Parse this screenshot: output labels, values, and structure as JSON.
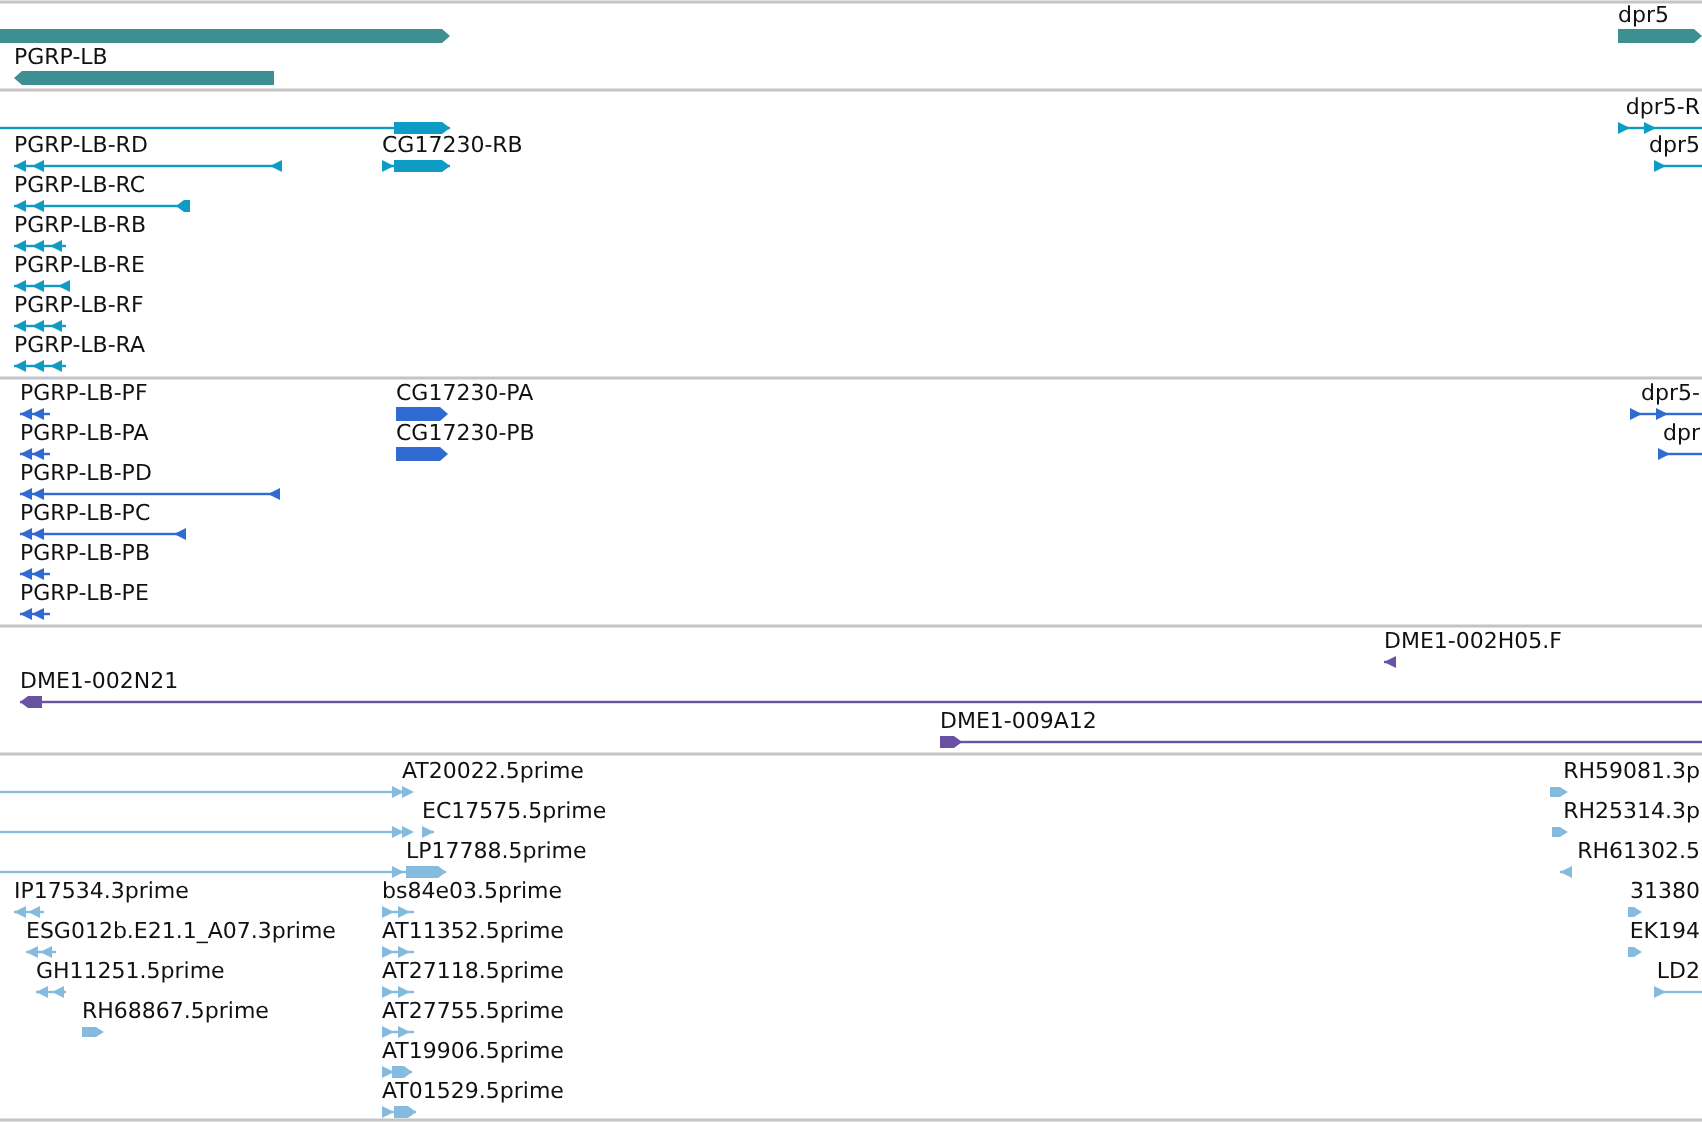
{
  "tracks": [
    {
      "features": [
        {
          "reverse": false
        },
        {
          "label": "PGRP-LB",
          "reverse": true
        },
        {
          "label": "dpr5",
          "reverse": false
        }
      ]
    },
    {
      "features": [
        {
          "reverse": false
        },
        {
          "label": "PGRP-LB-RD",
          "reverse": true
        },
        {
          "label": "CG17230-RB",
          "reverse": false
        },
        {
          "label": "PGRP-LB-RC",
          "reverse": true
        },
        {
          "label": "PGRP-LB-RB",
          "reverse": true
        },
        {
          "label": "PGRP-LB-RE",
          "reverse": true
        },
        {
          "label": "PGRP-LB-RF",
          "reverse": true
        },
        {
          "label": "PGRP-LB-RA",
          "reverse": true
        },
        {
          "label": "dpr5-R",
          "reverse": false
        },
        {
          "label": "dpr5",
          "reverse": false
        }
      ]
    },
    {
      "features": [
        {
          "label": "PGRP-LB-PF",
          "reverse": true
        },
        {
          "label": "PGRP-LB-PA",
          "reverse": true
        },
        {
          "label": "PGRP-LB-PD",
          "reverse": true
        },
        {
          "label": "PGRP-LB-PC",
          "reverse": true
        },
        {
          "label": "PGRP-LB-PB",
          "reverse": true
        },
        {
          "label": "PGRP-LB-PE",
          "reverse": true
        },
        {
          "label": "CG17230-PA",
          "reverse": false
        },
        {
          "label": "CG17230-PB",
          "reverse": false
        },
        {
          "label": "dpr5-",
          "reverse": false
        },
        {
          "label": "dpr",
          "reverse": false
        }
      ]
    },
    {
      "features": [
        {
          "label": "DME1-002H05.F",
          "reverse": true
        },
        {
          "label": "DME1-002N21",
          "reverse": true
        },
        {
          "label": "DME1-009A12",
          "reverse": false
        }
      ]
    },
    {
      "features": [
        {
          "label": "AT20022.5prime",
          "reverse": false
        },
        {
          "reverse": false
        },
        {
          "label": "EC17575.5prime",
          "reverse": false
        },
        {
          "label": "LP17788.5prime",
          "reverse": false
        },
        {
          "label": "IP17534.3prime",
          "reverse": true
        },
        {
          "label": "ESG012b.E21.1_A07.3prime",
          "reverse": true
        },
        {
          "label": "GH11251.5prime",
          "reverse": true
        },
        {
          "label": "RH68867.5prime",
          "reverse": false
        },
        {
          "label": "bs84e03.5prime",
          "reverse": false
        },
        {
          "label": "AT11352.5prime",
          "reverse": false
        },
        {
          "label": "AT27118.5prime",
          "reverse": false
        },
        {
          "label": "AT27755.5prime",
          "reverse": false
        },
        {
          "label": "AT19906.5prime",
          "reverse": false
        },
        {
          "label": "AT01529.5prime",
          "reverse": false
        },
        {
          "label": "RH59081.3p",
          "reverse": false
        },
        {
          "label": "RH25314.3p",
          "reverse": false
        },
        {
          "label": "RH61302.5",
          "reverse": true
        },
        {
          "label": "31380",
          "reverse": false
        },
        {
          "label": "EK194",
          "reverse": false
        },
        {
          "label": "LD2",
          "reverse": false
        }
      ]
    }
  ]
}
